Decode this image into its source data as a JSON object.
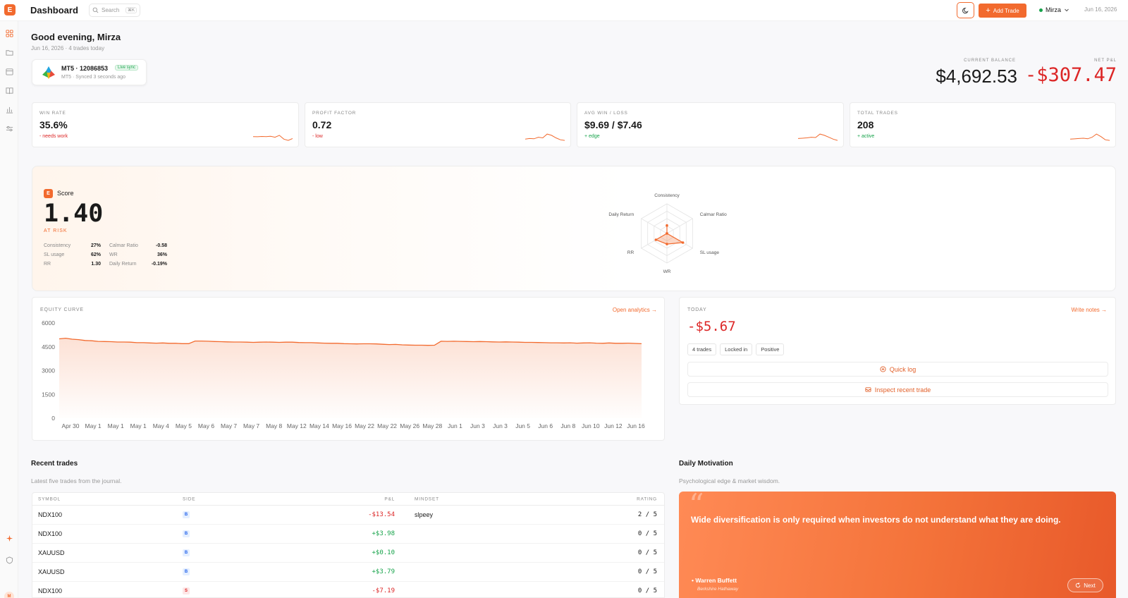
{
  "app": {
    "logo_letter": "E",
    "title": "Dashboard",
    "date": "Jun 16, 2026"
  },
  "search": {
    "placeholder": "Search",
    "shortcut": "⌘K"
  },
  "toolbar": {
    "add_trade_label": "Add Trade",
    "user_name": "Mirza"
  },
  "sidebar": {
    "items": [
      "dashboard-icon",
      "folder-icon",
      "calendar-icon",
      "book-icon",
      "bar-chart-icon",
      "sliders-icon"
    ],
    "bottom_items": [
      "sparkle-icon",
      "shield-icon"
    ],
    "avatar_letter": "M"
  },
  "greeting": {
    "title": "Good evening, Mirza",
    "subtitle": "Jun 16, 2026 · 4 trades today"
  },
  "account": {
    "name": "MT5 · 12086853",
    "badge": "Live sync",
    "sub": "MT5 · Synced 3 seconds ago"
  },
  "balance": {
    "label": "CURRENT BALANCE",
    "value": "$4,692.53"
  },
  "net_pnl": {
    "label": "NET P&L",
    "value": "-$307.47"
  },
  "stats": [
    {
      "label": "WIN RATE",
      "value": "35.6%",
      "note": "- needs work",
      "tone": "neg",
      "spark": [
        0.35,
        0.34,
        0.36,
        0.35,
        0.38,
        0.3,
        0.45,
        0.15,
        0.05,
        0.2
      ]
    },
    {
      "label": "PROFIT FACTOR",
      "value": "0.72",
      "note": "- low",
      "tone": "neg",
      "spark": [
        0.15,
        0.2,
        0.18,
        0.3,
        0.25,
        0.55,
        0.45,
        0.25,
        0.1,
        0.05
      ]
    },
    {
      "label": "AVG WIN / LOSS",
      "value": "$9.69 / $7.46",
      "note": "+ edge",
      "tone": "pos",
      "spark": [
        0.2,
        0.22,
        0.25,
        0.3,
        0.28,
        0.55,
        0.45,
        0.3,
        0.15,
        0.05
      ]
    },
    {
      "label": "TOTAL TRADES",
      "value": "208",
      "note": "+ active",
      "tone": "pos",
      "spark": [
        0.15,
        0.17,
        0.2,
        0.22,
        0.18,
        0.3,
        0.55,
        0.35,
        0.1,
        0.05
      ]
    }
  ],
  "score": {
    "badge": "E",
    "title": "Score",
    "value": "1.40",
    "status": "AT RISK",
    "metrics": [
      {
        "k1": "Consistency",
        "v1": "27%",
        "k2": "Calmar Ratio",
        "v2": "-0.58"
      },
      {
        "k1": "SL usage",
        "v1": "62%",
        "k2": "WR",
        "v2": "36%"
      },
      {
        "k1": "RR",
        "v1": "1.30",
        "k2": "Daily Return",
        "v2": "-0.19%"
      }
    ],
    "radar_axes": [
      "Consistency",
      "Calmar Ratio",
      "SL usage",
      "WR",
      "RR",
      "Daily Return"
    ],
    "radar_values": [
      0.27,
      0.0,
      0.62,
      0.36,
      0.43,
      0.0
    ]
  },
  "equity": {
    "title": "EQUITY CURVE",
    "link": "Open analytics →",
    "chart_data": {
      "type": "area",
      "y_ticks": [
        "6000",
        "4500",
        "3000",
        "1500",
        "0"
      ],
      "ylim": [
        0,
        6000
      ],
      "x_labels": [
        "Apr 30",
        "May 1",
        "May 1",
        "May 1",
        "May 4",
        "May 5",
        "May 6",
        "May 7",
        "May 7",
        "May 8",
        "May 12",
        "May 14",
        "May 16",
        "May 22",
        "May 22",
        "May 26",
        "May 28",
        "Jun 1",
        "Jun 3",
        "Jun 3",
        "Jun 5",
        "Jun 6",
        "Jun 8",
        "Jun 10",
        "Jun 12",
        "Jun 16"
      ],
      "values": [
        5000,
        5040,
        4980,
        4950,
        4900,
        4880,
        4840,
        4830,
        4820,
        4800,
        4800,
        4790,
        4760,
        4760,
        4740,
        4730,
        4740,
        4720,
        4720,
        4700,
        4700,
        4860,
        4860,
        4850,
        4830,
        4820,
        4810,
        4800,
        4800,
        4790,
        4780,
        4790,
        4800,
        4790,
        4780,
        4790,
        4790,
        4770,
        4760,
        4760,
        4740,
        4730,
        4720,
        4720,
        4700,
        4690,
        4680,
        4690,
        4690,
        4680,
        4660,
        4640,
        4650,
        4620,
        4610,
        4600,
        4600,
        4590,
        4600,
        4850,
        4840,
        4850,
        4840,
        4830,
        4820,
        4830,
        4820,
        4810,
        4800,
        4810,
        4800,
        4790,
        4780,
        4780,
        4770,
        4760,
        4750,
        4750,
        4740,
        4750,
        4730,
        4740,
        4750,
        4730,
        4720,
        4740,
        4720,
        4720,
        4730,
        4710,
        4693
      ]
    }
  },
  "today": {
    "title": "TODAY",
    "link": "Write notes →",
    "value": "-$5.67",
    "chips": [
      "4 trades",
      "Locked in",
      "Positive"
    ],
    "quick_log": "Quick log",
    "inspect": "Inspect recent trade"
  },
  "recent_trades": {
    "title": "Recent trades",
    "subtitle": "Latest five trades from the journal.",
    "columns": [
      "SYMBOL",
      "SIDE",
      "P&L",
      "MINDSET",
      "RATING"
    ],
    "rows": [
      {
        "symbol": "NDX100",
        "side": "B",
        "pnl": "-$13.54",
        "mindset": "slpeey",
        "rating": "2 / 5"
      },
      {
        "symbol": "NDX100",
        "side": "B",
        "pnl": "+$3.98",
        "mindset": "",
        "rating": "0 / 5"
      },
      {
        "symbol": "XAUUSD",
        "side": "B",
        "pnl": "+$0.10",
        "mindset": "",
        "rating": "0 / 5"
      },
      {
        "symbol": "XAUUSD",
        "side": "B",
        "pnl": "+$3.79",
        "mindset": "",
        "rating": "0 / 5"
      },
      {
        "symbol": "NDX100",
        "side": "S",
        "pnl": "-$7.19",
        "mindset": "",
        "rating": "0 / 5"
      }
    ]
  },
  "motivation": {
    "title": "Daily Motivation",
    "subtitle": "Psychological edge & market wisdom.",
    "quote": "Wide diversification is only required when investors do not understand what they are doing.",
    "author": "Warren Buffett",
    "org": "Berkshire Hathaway",
    "next": "Next"
  },
  "colors": {
    "accent": "#f26a2e",
    "negative": "#dc2626",
    "positive": "#16a34a"
  }
}
